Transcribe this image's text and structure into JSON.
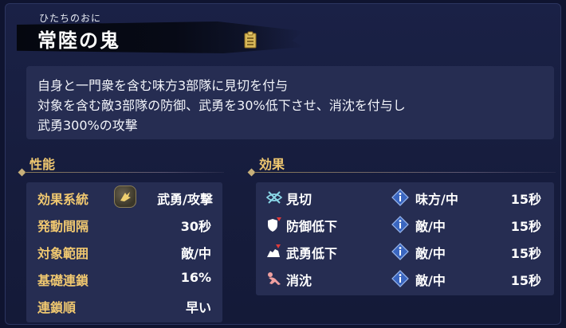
{
  "header": {
    "furigana": "ひたちのおに",
    "title": "常陸の鬼",
    "doc_icon": "document-icon"
  },
  "description": {
    "lines": [
      "自身と一門衆を含む味方3部隊に見切を付与",
      "対象を含む敵3部隊の防御、武勇を30%低下させ、消沈を付与し",
      "武勇300%の攻撃"
    ]
  },
  "performance": {
    "label": "性能",
    "rows": [
      {
        "label": "効果系統",
        "value": "武勇/攻撃",
        "icon": "valor-attack-icon"
      },
      {
        "label": "発動間隔",
        "value": "30秒"
      },
      {
        "label": "対象範囲",
        "value": "敵/中"
      },
      {
        "label": "基礎連鎖",
        "value": "16%"
      },
      {
        "label": "連鎖順",
        "value": "早い"
      }
    ]
  },
  "effects": {
    "label": "効果",
    "rows": [
      {
        "icon": "mikiri-icon",
        "name": "見切",
        "target": "味方/中",
        "duration": "15秒"
      },
      {
        "icon": "defense-down-icon",
        "name": "防御低下",
        "target": "敵/中",
        "duration": "15秒"
      },
      {
        "icon": "valor-down-icon",
        "name": "武勇低下",
        "target": "敵/中",
        "duration": "15秒"
      },
      {
        "icon": "dejection-icon",
        "name": "消沈",
        "target": "敵/中",
        "duration": "15秒"
      }
    ]
  },
  "colors": {
    "background": "#1a2146",
    "panel": "#262d52",
    "gold_label": "#f0c870",
    "text": "#ffffff",
    "info_blue": "#5a8ee0"
  }
}
